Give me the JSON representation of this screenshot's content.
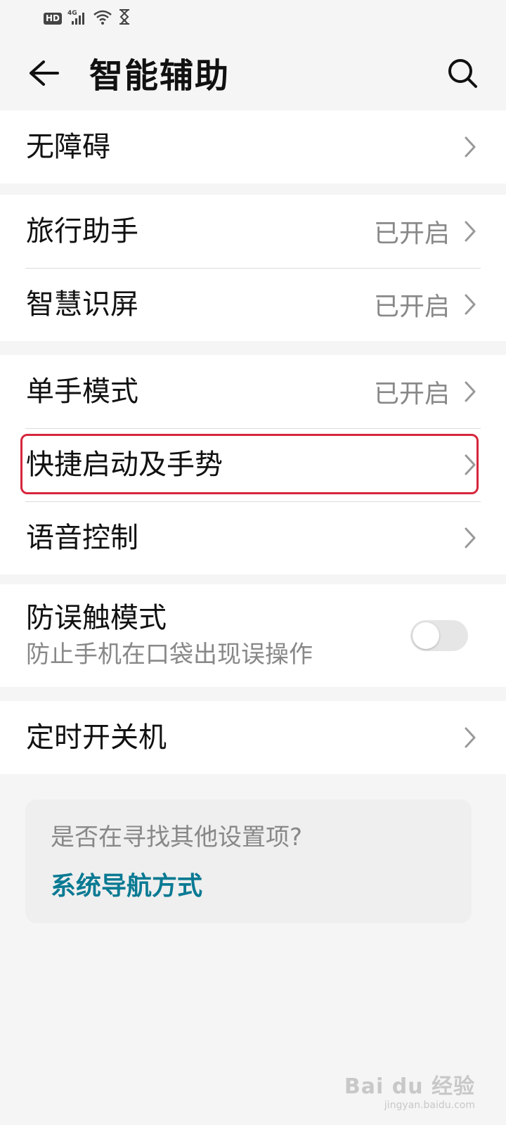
{
  "status_bar": {
    "hd": "HD",
    "network": "4G"
  },
  "header": {
    "title": "智能辅助"
  },
  "groups": [
    {
      "items": [
        {
          "label": "无障碍",
          "value": ""
        }
      ]
    },
    {
      "items": [
        {
          "label": "旅行助手",
          "value": "已开启"
        },
        {
          "label": "智慧识屏",
          "value": "已开启"
        }
      ]
    },
    {
      "items": [
        {
          "label": "单手模式",
          "value": "已开启"
        },
        {
          "label": "快捷启动及手势",
          "value": ""
        },
        {
          "label": "语音控制",
          "value": ""
        }
      ]
    },
    {
      "items": [
        {
          "label": "防误触模式",
          "subtitle": "防止手机在口袋出现误操作",
          "toggle_on": false
        }
      ]
    },
    {
      "items": [
        {
          "label": "定时开关机",
          "value": ""
        }
      ]
    }
  ],
  "suggestion": {
    "title": "是否在寻找其他设置项?",
    "link": "系统导航方式"
  },
  "colors": {
    "highlight": "#d7263d",
    "link": "#0a7a93",
    "background": "#f5f5f5"
  },
  "watermark": {
    "logo": "Bai du 经验",
    "sub": "jingyan.baidu.com"
  }
}
